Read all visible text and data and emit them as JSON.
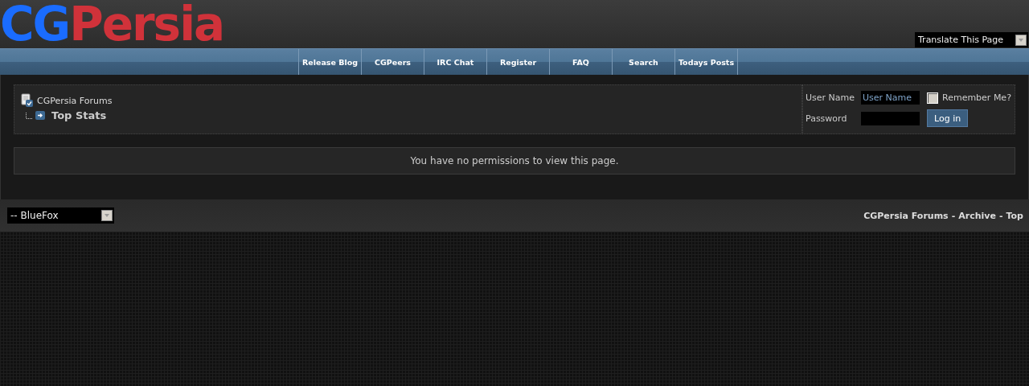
{
  "header": {
    "logo": [
      {
        "text": "CG",
        "color": "#1a6cff"
      },
      {
        "text": "Persia",
        "color": "#d0323a"
      }
    ],
    "translate_select": {
      "value": "Translate This Page"
    }
  },
  "nav": [
    "Release Blog",
    "CGPeers",
    "IRC Chat",
    "Register",
    "FAQ",
    "Search",
    "Todays Posts"
  ],
  "breadcrumb": {
    "root": "CGPersia Forums",
    "current": "Top Stats"
  },
  "login": {
    "username_label": "User Name",
    "username_placeholder": "User Name",
    "remember_label": "Remember Me?",
    "remember_checked": false,
    "password_label": "Password",
    "button": "Log in"
  },
  "message": "You have no permissions to view this page.",
  "footer": {
    "style_select": "-- BlueFox",
    "links": [
      "CGPersia Forums",
      "Archive",
      "Top"
    ],
    "separator": "-"
  }
}
